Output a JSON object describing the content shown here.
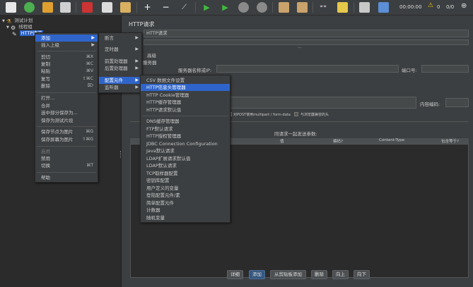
{
  "toolbar": {
    "timer": "00:00:00",
    "warn_count": "0",
    "threads": "0/0",
    "icons": [
      "new-icon",
      "templates-icon",
      "open-icon",
      "save-icon",
      "cut-icon",
      "copy-icon",
      "paste-icon",
      "expand-icon",
      "collapse-icon",
      "toggle-icon",
      "start-icon",
      "start-no-pause-icon",
      "stop-icon",
      "shutdown-icon",
      "clear-icon",
      "clear-all-icon",
      "search-icon",
      "reset-search-icon",
      "function-helper-icon",
      "help-icon"
    ]
  },
  "tree": {
    "root": "测试计划",
    "group": "线程组",
    "selected": "HTTP请求"
  },
  "panel": {
    "title": "HTTP请求",
    "name_value": "HTTP请求",
    "ellipsis": "...",
    "partial_1": "高级",
    "partial_2": "服务器",
    "server_label": "服务器名称或IP:",
    "port_label": "端口号:",
    "encoding_label": "内容编码:",
    "multipart_label": "对POST使用multipart / form-data",
    "browser_headers_label": "与浏览器兼容的头",
    "send_params_label": "同请求一起发送参数:",
    "col_value": "值",
    "col_encode": "编码?",
    "col_ctype": "Content-Type",
    "col_include": "包含等于?"
  },
  "buttons": {
    "detail": "详细",
    "add": "添加",
    "add_clip": "从剪贴板添加",
    "delete": "删除",
    "up": "向上",
    "down": "向下"
  },
  "menu1": {
    "items": [
      {
        "label": "添加",
        "key": "",
        "arrow": "▶"
      },
      {
        "label": "插入上级",
        "key": "",
        "arrow": "▶"
      },
      {
        "label": "剪切",
        "key": "⌘X",
        "arrow": ""
      },
      {
        "label": "复制",
        "key": "⌘C",
        "arrow": ""
      },
      {
        "label": "粘贴",
        "key": "⌘V",
        "arrow": ""
      },
      {
        "label": "复写",
        "key": "⇧⌘C",
        "arrow": ""
      },
      {
        "label": "删除",
        "key": "⌦",
        "arrow": ""
      },
      {
        "label": "打开...",
        "key": "",
        "arrow": ""
      },
      {
        "label": "合并",
        "key": "",
        "arrow": ""
      },
      {
        "label": "选中部分保存为...",
        "key": "",
        "arrow": ""
      },
      {
        "label": "保存为测试片段",
        "key": "",
        "arrow": ""
      },
      {
        "label": "保存节点为图片",
        "key": "⌘G",
        "arrow": ""
      },
      {
        "label": "保存屏幕为图片",
        "key": "⇧⌘G",
        "arrow": ""
      },
      {
        "label": "启用",
        "key": "",
        "arrow": ""
      },
      {
        "label": "禁用",
        "key": "",
        "arrow": ""
      },
      {
        "label": "切换",
        "key": "⌘T",
        "arrow": ""
      },
      {
        "label": "帮助",
        "key": "",
        "arrow": ""
      }
    ]
  },
  "menu2": {
    "items": [
      {
        "label": "断言",
        "arrow": "▶"
      },
      {
        "label": "定时器",
        "arrow": "▶"
      },
      {
        "label": "前置处理器",
        "arrow": "▶"
      },
      {
        "label": "后置处理器",
        "arrow": "▶"
      },
      {
        "label": "配置元件",
        "arrow": "▶"
      },
      {
        "label": "监听器",
        "arrow": "▶"
      }
    ]
  },
  "menu3": {
    "items": [
      "CSV 数据文件设置",
      "HTTP信息头管理器",
      "HTTP Cookie管理器",
      "HTTP缓存管理器",
      "HTTP请求默认值",
      "DNS缓存管理器",
      "FTP默认请求",
      "HTTP授权管理器",
      "JDBC Connection Configuration",
      "Java默认请求",
      "LDAP扩展请求默认值",
      "LDAP默认请求",
      "TCP取样器配置",
      "密钥库配置",
      "用户定义的变量",
      "登陆配置元件/素",
      "简单配置元件",
      "计数器",
      "随机变量"
    ]
  },
  "colors": {
    "highlight": "#2f65ca",
    "bg": "#3c3f41"
  }
}
